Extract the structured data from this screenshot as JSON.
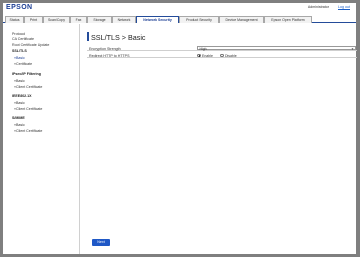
{
  "header": {
    "logo": "EPSON",
    "admin": "Administrator",
    "logout": "Log out"
  },
  "tabs": [
    {
      "label": "Status"
    },
    {
      "label": "Print"
    },
    {
      "label": "Scan/Copy"
    },
    {
      "label": "Fax"
    },
    {
      "label": "Storage"
    },
    {
      "label": "Network"
    },
    {
      "label": "Network Security"
    },
    {
      "label": "Product Security"
    },
    {
      "label": "Device Management"
    },
    {
      "label": "Epson Open Platform"
    }
  ],
  "sidebar": {
    "items": [
      {
        "label": "Protocol"
      },
      {
        "label": "CA Certificate"
      },
      {
        "label": "Root Certificate Update"
      },
      {
        "label": "SSL/TLS"
      },
      {
        "label": "»Basic"
      },
      {
        "label": "»Certificate"
      },
      {
        "label": "IPsec/IP Filtering"
      },
      {
        "label": "»Basic"
      },
      {
        "label": "»Client Certificate"
      },
      {
        "label": "IEEE802.1X"
      },
      {
        "label": "»Basic"
      },
      {
        "label": "»Client Certificate"
      },
      {
        "label": "S/MIME"
      },
      {
        "label": "»Basic"
      },
      {
        "label": "»Client Certificate"
      }
    ]
  },
  "main": {
    "title": "SSL/TLS > Basic",
    "encryption_label": "Encryption Strength",
    "encryption_value": "High",
    "redirect_label": "Redirect HTTP to HTTPS",
    "enable_label": "Enable",
    "disable_label": "Disable",
    "next_label": "Next"
  }
}
